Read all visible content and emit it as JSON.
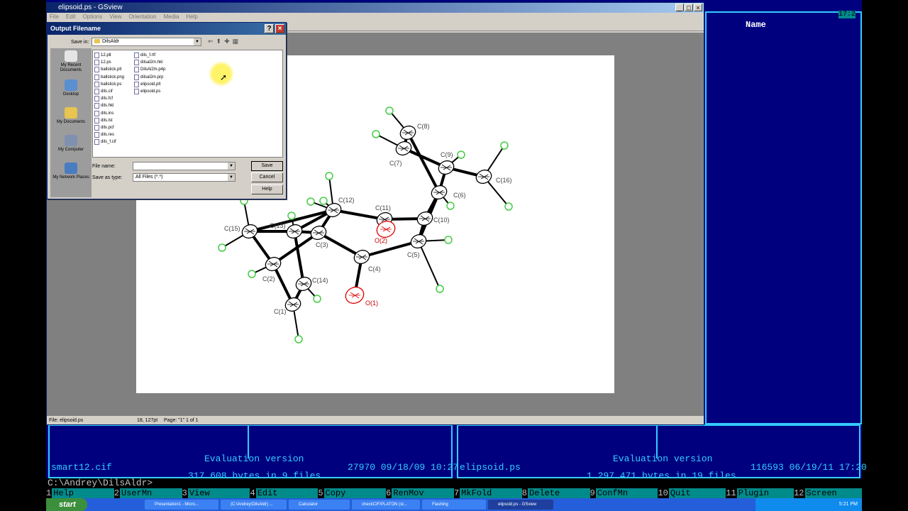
{
  "far": {
    "right_header": "Name",
    "clock": "17:2",
    "left_panel": {
      "eval": "Evaluation version",
      "file": "smart12.cif",
      "file_info": "27970 09/18/09 10:27",
      "totals": "317,608 bytes in 9 files"
    },
    "right_panel": {
      "eval": "Evaluation version",
      "file": "elipsoid.ps",
      "file_info": "116593 06/19/11 17:20",
      "totals": "1,297,471 bytes in 19 files"
    },
    "cmdline": "C:\\Andrey\\DilsAldr>",
    "keys": [
      {
        "n": "1",
        "l": "Help"
      },
      {
        "n": "2",
        "l": "UserMn"
      },
      {
        "n": "3",
        "l": "View"
      },
      {
        "n": "4",
        "l": "Edit"
      },
      {
        "n": "5",
        "l": "Copy"
      },
      {
        "n": "6",
        "l": "RenMov"
      },
      {
        "n": "7",
        "l": "MkFold"
      },
      {
        "n": "8",
        "l": "Delete"
      },
      {
        "n": "9",
        "l": "ConfMn"
      },
      {
        "n": "10",
        "l": "Quit"
      },
      {
        "n": "11",
        "l": "Plugin"
      },
      {
        "n": "12",
        "l": "Screen"
      }
    ]
  },
  "gsview": {
    "title": "elipsoid.ps - GSview",
    "menu": [
      "File",
      "Edit",
      "Options",
      "View",
      "Orientation",
      "Media",
      "Help"
    ],
    "status_file": "File: elipsoid.ps",
    "status_pos": "18, 127pt",
    "status_page": "Page: \"1\"  1 of 1"
  },
  "dialog": {
    "title": "Output Filename",
    "save_in_label": "Save in:",
    "save_in_value": "DilsAldr",
    "places": [
      "My Recent Documents",
      "Desktop",
      "My Documents",
      "My Computer",
      "My Network Places"
    ],
    "files_col1": [
      "12.plt",
      "12.ps",
      "ballstick.plt",
      "ballstick.png",
      "ballstick.ps",
      "dils.cif",
      "dils.fcf",
      "dils.hkl",
      "dils.ins",
      "dils.lst",
      "dils.pcf",
      "dils.res",
      "dils_f.cif"
    ],
    "files_col2": [
      "dils_f.rtf",
      "dilsal2m.hkl",
      "DilsAl2m.p4p",
      "dilsal2m.prp",
      "elipsoid.plt",
      "elipsoid.ps"
    ],
    "filename_label": "File name:",
    "filename_value": "",
    "savetype_label": "Save as type:",
    "savetype_value": "All Files (*.*)",
    "save_btn": "Save",
    "cancel_btn": "Cancel",
    "help_btn": "Help"
  },
  "molecule": {
    "labels": [
      "C(8)",
      "C(9)",
      "C(7)",
      "C(16)",
      "C(6)",
      "C(12)",
      "C(11)",
      "C(10)",
      "C(15)",
      "C(13)",
      "O(2)",
      "C(3)",
      "C(5)",
      "C(4)",
      "C(2)",
      "C(14)",
      "O(1)",
      "C(1)"
    ]
  },
  "taskbar": {
    "start": "start",
    "tasks": [
      "Presentation1 - Micro...",
      "(C:\\Andrey\\DilsAldr) ...",
      "Calculator",
      "checkCIF/PLATON (st...",
      "Flashing",
      "elipsoid.ps - GSview"
    ],
    "time": "5:21 PM"
  }
}
